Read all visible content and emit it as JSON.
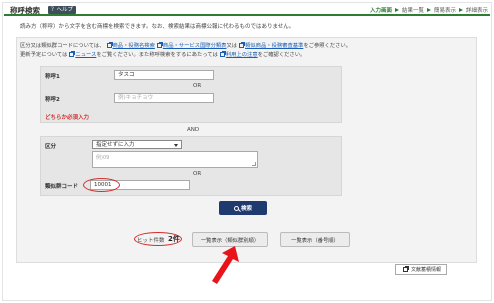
{
  "header": {
    "title": "称呼検索",
    "help_label": "？ヘルプ",
    "steps": [
      {
        "label": "入力画面",
        "active": true
      },
      {
        "label": "結果一覧",
        "active": false
      },
      {
        "label": "簡易表示",
        "active": false
      },
      {
        "label": "詳細表示",
        "active": false
      }
    ]
  },
  "intro": "読み方（称呼）から文字を含む商標を検索できます。なお、検索結果は商標公報に代わるものではありません。",
  "info": {
    "line1_a": "区分又は類似群コードについては、",
    "link1": "商品・役務名検索",
    "link2": "商品・サービス国際分類表",
    "line1_b": "又は",
    "link3": "類似商品・役務審査基準",
    "line1_c": "をご参照ください。",
    "line2_a": "更新予定については",
    "link4": "ニュース",
    "line2_b": "をご覧ください。また称呼検索をするにあたっては",
    "link5": "利用上の注意",
    "line2_c": "をご確認ください。"
  },
  "form": {
    "field1_label": "称呼1",
    "field1_value": "タスコ",
    "or1": "OR",
    "field2_label": "称呼2",
    "field2_placeholder": "例)キョチョウ",
    "required_note": "どちらか必須入力",
    "and": "AND",
    "class_label": "区分",
    "class_select": "指定せずに入力",
    "class_textarea_placeholder": "例)09",
    "or2": "OR",
    "group_code_label": "類似群コード",
    "group_code_value": "10001"
  },
  "search_button": "検索",
  "results": {
    "count_label": "ヒット件数",
    "count_value": "2件",
    "list_by_class": "一覧表示（類似群別順）",
    "list_by_number": "一覧表示（番号順）"
  },
  "doc_button": "文献蓄積情報",
  "colors": {
    "accent_green": "#2e7d32",
    "button_navy": "#1e3a6e",
    "annotation_red": "#d32f2f",
    "link_blue": "#1a5fb4"
  }
}
